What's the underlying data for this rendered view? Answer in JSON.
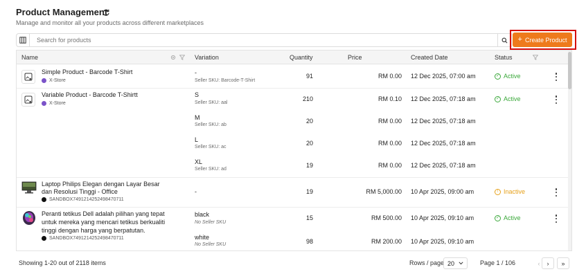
{
  "header": {
    "title": "Product Management",
    "subtitle": "Manage and monitor all your products across different marketplaces"
  },
  "toolbar": {
    "search_placeholder": "Search for products",
    "create_label": "Create Product",
    "create_color": "#ee7a1c",
    "highlight_color": "#d40d0d"
  },
  "table": {
    "columns": {
      "name": "Name",
      "variation": "Variation",
      "quantity": "Quantity",
      "price": "Price",
      "created": "Created Date",
      "status": "Status"
    },
    "rows": [
      {
        "name": "Simple Product - Barcode T-Shirt",
        "store": "X-Store",
        "variation": "-",
        "sku": "Seller SKU: Barcode-T-Shirt",
        "quantity": "91",
        "price": "RM 0.00",
        "created": "12 Dec 2025, 07:00 am",
        "status": "Active"
      },
      {
        "name": "Variable Product - Barcode T-Shirtt",
        "store": "X-Store",
        "variation": "S",
        "sku": "Seller SKU: aal",
        "quantity": "210",
        "price": "RM 0.10",
        "created": "12 Dec 2025, 07:18 am",
        "status": "Active"
      },
      {
        "variation": "M",
        "sku": "Seller SKU: ab",
        "quantity": "20",
        "price": "RM 0.00",
        "created": "12 Dec 2025, 07:18 am"
      },
      {
        "variation": "L",
        "sku": "Seller SKU: ac",
        "quantity": "20",
        "price": "RM 0.00",
        "created": "12 Dec 2025, 07:18 am"
      },
      {
        "variation": "XL",
        "sku": "Seller SKU: ad",
        "quantity": "19",
        "price": "RM 0.00",
        "created": "12 Dec 2025, 07:18 am"
      },
      {
        "name_line1": "Laptop Philips Elegan dengan Layar Besar",
        "name_line2": "dan Resolusi Tinggi - Office",
        "store": "SANDBOX7491214252498470711",
        "variation": "-",
        "quantity": "19",
        "price": "RM 5,000.00",
        "created": "10 Apr 2025, 09:00 am",
        "status": "Inactive"
      },
      {
        "name_line1": "Peranti tetikus Dell adalah pilihan yang tepat",
        "name_line2": "untuk mereka yang mencari tetikus berkualiti",
        "name_line3": "tinggi dengan harga yang berpatutan.",
        "store": "SANDBOX7491214252498470711",
        "variation": "black",
        "sku": "No Seller SKU",
        "quantity": "15",
        "price": "RM 500.00",
        "created": "10 Apr 2025, 09:10 am",
        "status": "Active"
      },
      {
        "variation": "white",
        "sku": "No Seller SKU",
        "quantity": "98",
        "price": "RM 200.00",
        "created": "10 Apr 2025, 09:10 am"
      }
    ]
  },
  "status_colors": {
    "active": "#3aa83a",
    "inactive": "#e6a019"
  },
  "footer": {
    "showing": "Showing 1-20 out of 2118 items",
    "rows_label": "Rows / page",
    "rows_value": "20",
    "page_label": "Page 1 / 106",
    "first": "«",
    "prev": "‹",
    "next": "›",
    "last": "»"
  }
}
